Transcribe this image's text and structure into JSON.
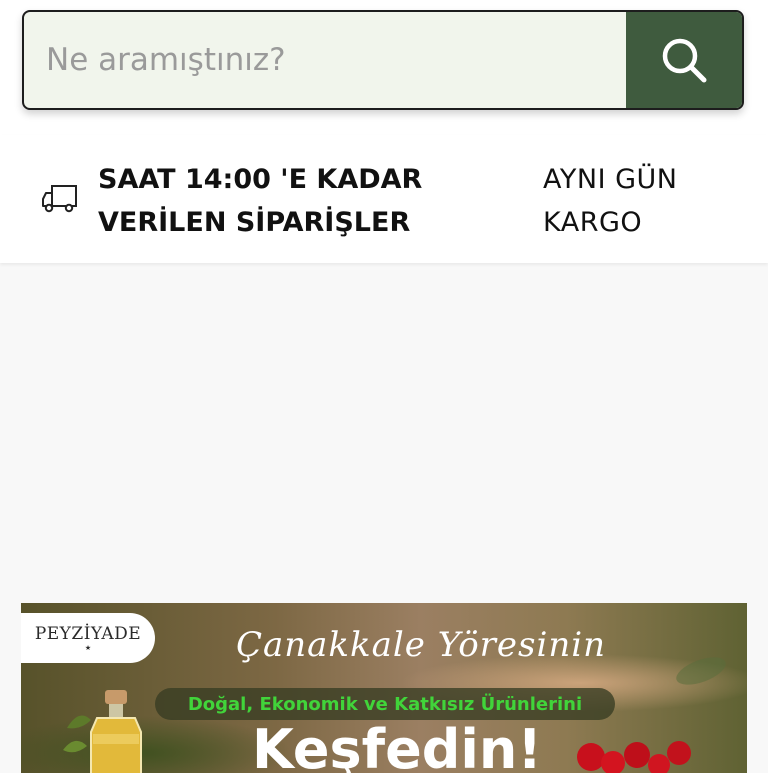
{
  "search": {
    "placeholder": "Ne aramıştınız?",
    "value": "",
    "button_icon": "search-icon"
  },
  "shipping": {
    "icon": "truck-icon",
    "left_line1": "SAAT 14:00 'E KADAR",
    "left_line2": "VERİLEN SİPARİŞLER",
    "right_line1": "AYNI GÜN",
    "right_line2": "KARGO"
  },
  "banner": {
    "logo": "PEYZİYADE",
    "script_title": "Çanakkale Yöresinin",
    "subtitle": "Doğal, Ekonomik ve Katkısız Ürünlerini",
    "headline": "Keşfedin!"
  },
  "colors": {
    "search_button": "#3f5b3e",
    "search_field": "#f1f5ec",
    "subtitle_green": "#41d43a"
  }
}
